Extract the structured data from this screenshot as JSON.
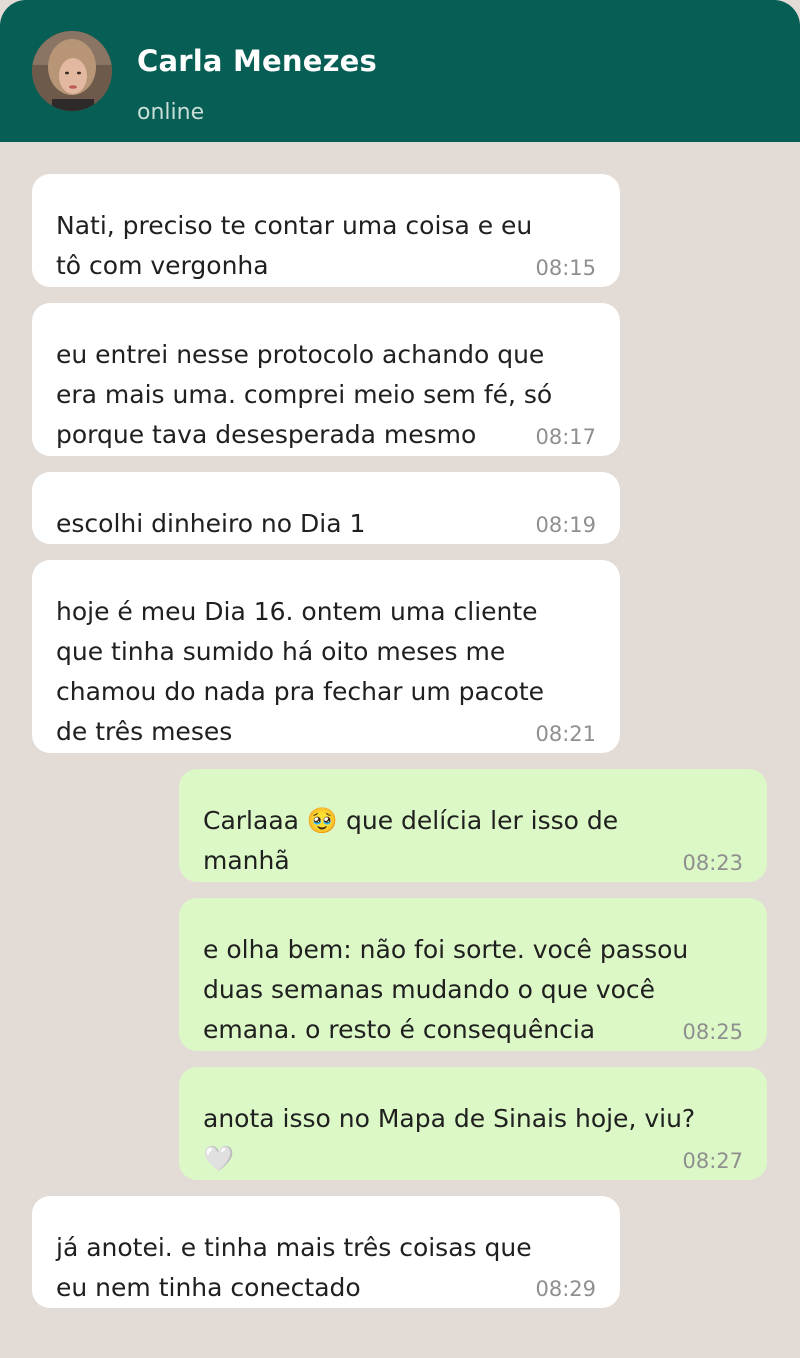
{
  "header": {
    "contact_name": "Carla Menezes",
    "status": "online"
  },
  "messages": [
    {
      "direction": "in",
      "text": "Nati, preciso te contar uma coisa e eu\ntô com vergonha",
      "time": "08:15"
    },
    {
      "direction": "in",
      "text": "eu entrei nesse protocolo achando que\nera mais uma. comprei meio sem fé, só\nporque tava desesperada mesmo",
      "time": "08:17"
    },
    {
      "direction": "in",
      "text": "escolhi dinheiro no Dia 1",
      "time": "08:19"
    },
    {
      "direction": "in",
      "text": "hoje é meu Dia 16. ontem uma cliente\nque tinha sumido há oito meses me\nchamou do nada pra fechar um pacote\nde três meses",
      "time": "08:21"
    },
    {
      "direction": "out",
      "text": "Carlaaa 🥹 que delícia ler isso de\nmanhã",
      "time": "08:23"
    },
    {
      "direction": "out",
      "text": "e olha bem: não foi sorte. você passou\nduas semanas mudando o que você\nemana. o resto é consequência",
      "time": "08:25"
    },
    {
      "direction": "out",
      "text": "anota isso no Mapa de Sinais hoje, viu?\n🤍",
      "time": "08:27"
    },
    {
      "direction": "in",
      "text": "já anotei. e tinha mais três coisas que\neu nem tinha conectado",
      "time": "08:29"
    }
  ],
  "colors": {
    "header_bg": "#075e54",
    "chat_bg": "#e3dbd5",
    "incoming_bubble": "#ffffff",
    "outgoing_bubble": "#dcf8c6"
  }
}
